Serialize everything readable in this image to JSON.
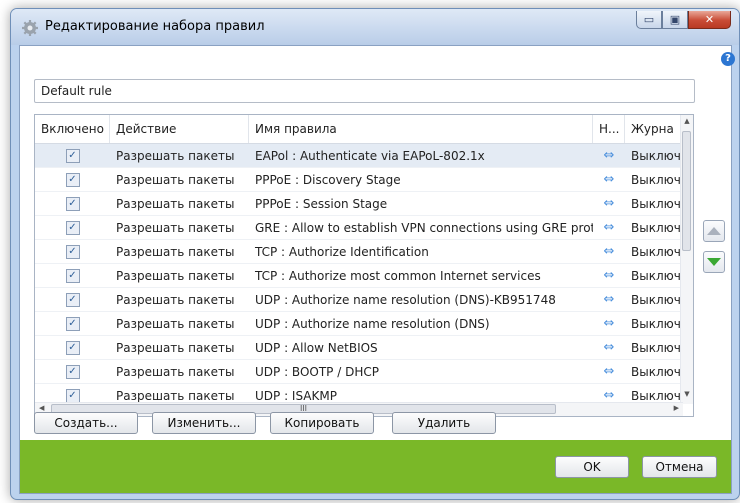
{
  "window": {
    "title": "Редактирование набора правил",
    "help_glyph": "?",
    "min_glyph": "▭",
    "max_glyph": "▣",
    "close_glyph": "✕"
  },
  "rule_set_name": "Default rule",
  "table": {
    "columns": [
      "Включено",
      "Действие",
      "Имя правила",
      "Н...",
      "Журна"
    ],
    "rows": [
      {
        "enabled": "✓",
        "action": "Разрешать пакеты",
        "name": "EAPol : Authenticate via EAPoL-802.1x",
        "direction": "⇔",
        "log": "Выключ"
      },
      {
        "enabled": "✓",
        "action": "Разрешать пакеты",
        "name": "PPPoE : Discovery Stage",
        "direction": "⇔",
        "log": "Выключ"
      },
      {
        "enabled": "✓",
        "action": "Разрешать пакеты",
        "name": "PPPoE : Session Stage",
        "direction": "⇔",
        "log": "Выключ"
      },
      {
        "enabled": "✓",
        "action": "Разрешать пакеты",
        "name": "GRE : Allow to establish VPN connections using GRE protocol",
        "direction": "⇔",
        "log": "Выключ"
      },
      {
        "enabled": "✓",
        "action": "Разрешать пакеты",
        "name": "TCP : Authorize Identification",
        "direction": "⇔",
        "log": "Выключ"
      },
      {
        "enabled": "✓",
        "action": "Разрешать пакеты",
        "name": "TCP : Authorize most common Internet services",
        "direction": "⇔",
        "log": "Выключ"
      },
      {
        "enabled": "✓",
        "action": "Разрешать пакеты",
        "name": "UDP : Authorize name resolution (DNS)-KB951748",
        "direction": "⇔",
        "log": "Выключ"
      },
      {
        "enabled": "✓",
        "action": "Разрешать пакеты",
        "name": "UDP : Authorize name resolution (DNS)",
        "direction": "⇔",
        "log": "Выключ"
      },
      {
        "enabled": "✓",
        "action": "Разрешать пакеты",
        "name": "UDP : Allow NetBIOS",
        "direction": "⇔",
        "log": "Выключ"
      },
      {
        "enabled": "✓",
        "action": "Разрешать пакеты",
        "name": "UDP : BOOTP / DHCP",
        "direction": "⇔",
        "log": "Выключ"
      },
      {
        "enabled": "✓",
        "action": "Разрешать пакеты",
        "name": "UDP : ISAKMP",
        "direction": "⇔",
        "log": "Выключ"
      }
    ],
    "hscroll_glyph": "III"
  },
  "buttons": {
    "create": "Создать...",
    "edit": "Изменить...",
    "copy": "Копировать",
    "delete": "Удалить",
    "ok": "OK",
    "cancel": "Отмена"
  },
  "colors": {
    "footer": "#7ab828",
    "selected_row": "#e4ebf4",
    "move_down_arrow": "#3aa833"
  }
}
